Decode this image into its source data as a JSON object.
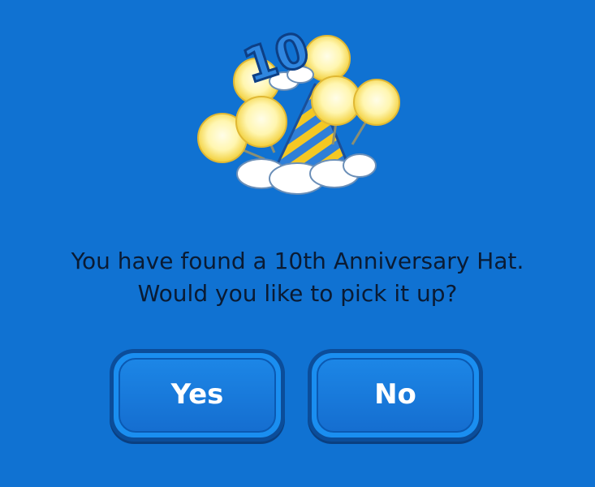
{
  "dialog": {
    "message_line1": "You have found a 10th Anniversary Hat.",
    "message_line2": "Would you like to pick it up?",
    "yes_label": "Yes",
    "no_label": "No"
  },
  "item": {
    "icon": "anniversary-hat-icon",
    "hat_number": "10"
  },
  "colors": {
    "background": "#1072d2",
    "button_face": "#1a8ef0",
    "text": "#0a1b33",
    "button_text": "#ffffff"
  }
}
